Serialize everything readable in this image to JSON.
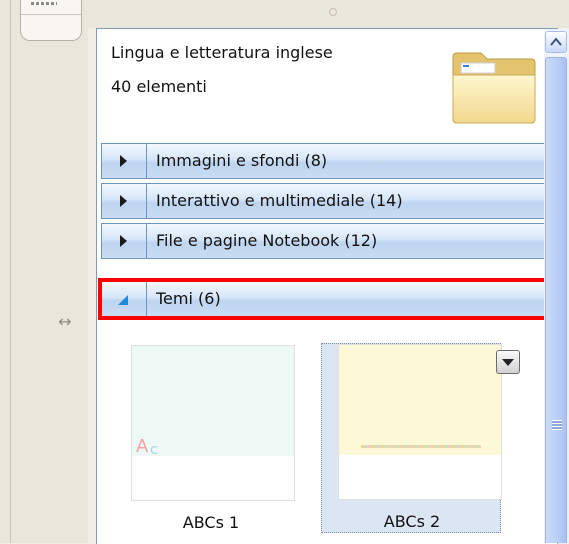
{
  "header": {
    "title": "Lingua e letteratura inglese",
    "count": "40 elementi"
  },
  "categories": [
    {
      "label": "Immagini e sfondi (8)",
      "expanded": false
    },
    {
      "label": "Interattivo e multimediale (14)",
      "expanded": false
    },
    {
      "label": "File e pagine Notebook (12)",
      "expanded": false
    },
    {
      "label": "Temi (6)",
      "expanded": true
    }
  ],
  "thumbnails": [
    {
      "label": "ABCs 1",
      "color": "#eef9f5"
    },
    {
      "label": "ABCs 2",
      "color": "#fdf9d6"
    }
  ],
  "colors": {
    "highlight": "#ff0000",
    "selected_bg": "#dce5f3",
    "row_border": "#6e95c2"
  },
  "icons": [
    "folder-icon",
    "expand-arrow-icon",
    "collapse-arrow-icon",
    "dropdown-arrow-icon",
    "resize-horizontal-icon",
    "scroll-up-icon"
  ]
}
